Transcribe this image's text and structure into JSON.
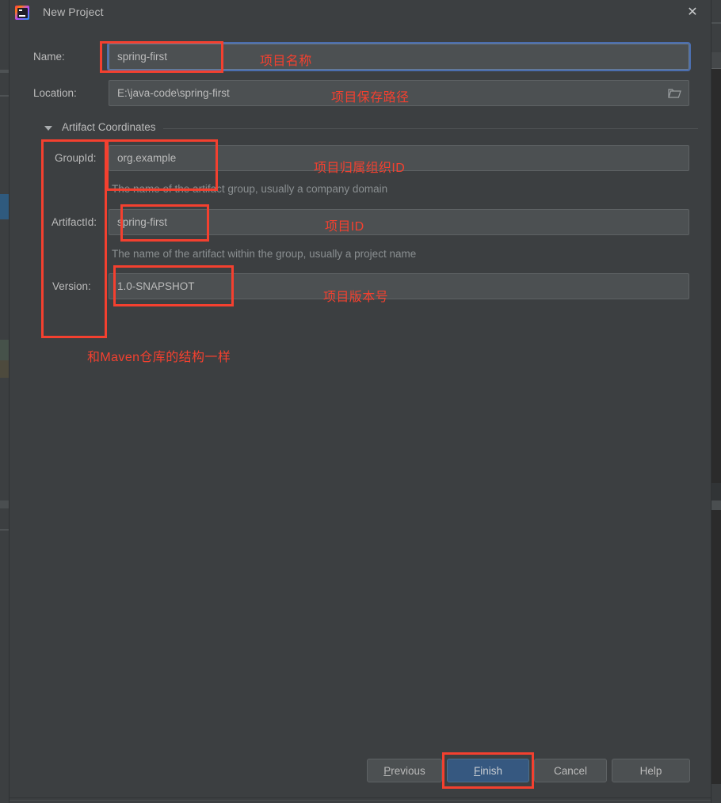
{
  "window": {
    "title": "New Project",
    "app_icon": "intellij-idea-icon",
    "close_label": "✕"
  },
  "form": {
    "name": {
      "label": "Name:",
      "value": "spring-first",
      "focused": true
    },
    "location": {
      "label": "Location:",
      "value": "E:\\java-code\\spring-first",
      "browse_icon": "folder-icon"
    },
    "section": {
      "label": "Artifact Coordinates",
      "expanded": true
    },
    "group_id": {
      "label": "GroupId:",
      "value": "org.example",
      "helper": "The name of the artifact group, usually a company domain"
    },
    "artifact_id": {
      "label": "ArtifactId:",
      "value": "spring-first",
      "helper": "The name of the artifact within the group, usually a project name"
    },
    "version": {
      "label": "Version:",
      "value": "1.0-SNAPSHOT"
    }
  },
  "annotations": {
    "color": "#f4402f",
    "name_note": "项目名称",
    "location_note": "项目保存路径",
    "group_note": "项目归属组织ID",
    "artifact_note": "项目ID",
    "version_note": "项目版本号",
    "maven_note": "和Maven仓库的结构一样"
  },
  "footer": {
    "previous": "Previous",
    "previous_mnemonic": "P",
    "previous_rest": "revious",
    "finish": "Finish",
    "finish_mnemonic": "F",
    "finish_rest": "inish",
    "cancel": "Cancel",
    "help": "Help"
  },
  "theme": {
    "dialog_bg": "#3c3f41",
    "input_bg": "#4c5052",
    "text": "#bbbbbb",
    "helper_text": "#8a8f91",
    "accent_blue": "#365880",
    "focus_blue": "#4b6eaf",
    "annotation_red": "#f4402f"
  }
}
